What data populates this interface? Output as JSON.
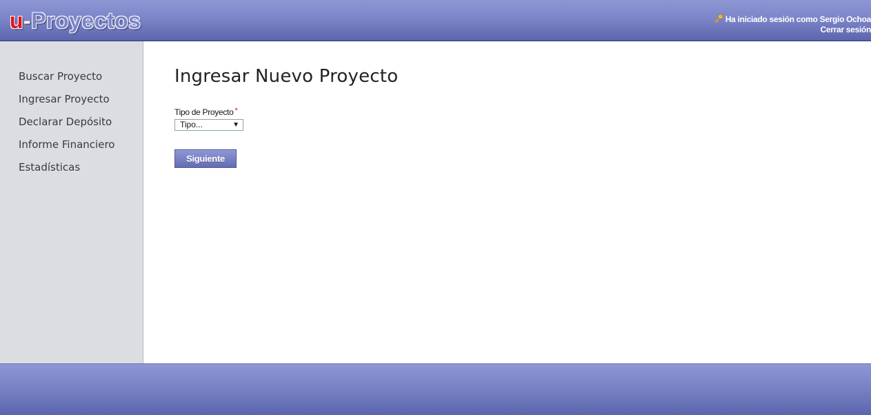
{
  "header": {
    "logo_u": "u",
    "logo_dash": "-",
    "logo_name": "Proyectos",
    "session_text": "Ha iniciado sesión como Sergio Ochoa",
    "logout_label": "Cerrar sesión",
    "key_icon": "key-icon"
  },
  "sidebar": {
    "items": [
      {
        "label": "Buscar Proyecto"
      },
      {
        "label": "Ingresar Proyecto"
      },
      {
        "label": "Declarar Depósito"
      },
      {
        "label": "Informe Financiero"
      },
      {
        "label": "Estadísticas"
      }
    ]
  },
  "main": {
    "title": "Ingresar Nuevo Proyecto",
    "field": {
      "label": "Tipo de Proyecto",
      "required_mark": "*",
      "selected": "Tipo..."
    },
    "next_label": "Siguiente"
  },
  "colors": {
    "header_bar": "#7a83c6",
    "sidebar_bg": "#dcdde2",
    "required": "#d0121a",
    "logo_u": "#e1141f"
  }
}
